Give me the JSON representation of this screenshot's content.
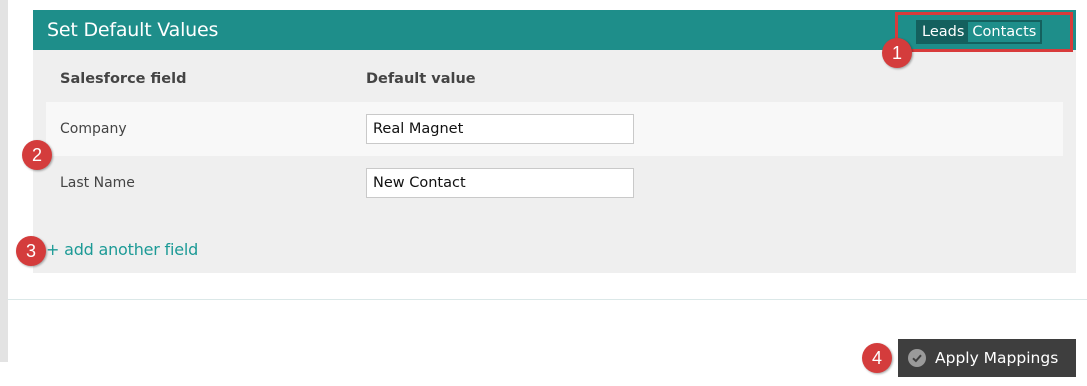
{
  "header": {
    "title": "Set Default Values",
    "toggle": {
      "options": [
        "Leads",
        "Contacts"
      ],
      "active": "Contacts"
    }
  },
  "table": {
    "columns": [
      "Salesforce field",
      "Default value"
    ],
    "rows": [
      {
        "field": "Company",
        "value": "Real Magnet"
      },
      {
        "field": "Last Name",
        "value": "New Contact"
      }
    ]
  },
  "add_field_label": "+ add another field",
  "apply_button_label": "Apply Mappings",
  "callouts": [
    "1",
    "2",
    "3",
    "4"
  ],
  "colors": {
    "header": "#1e8e8a",
    "toggle_bg": "#14605e",
    "callout": "#d43c3c",
    "link": "#1c9a96",
    "button": "#3e3e3e"
  }
}
